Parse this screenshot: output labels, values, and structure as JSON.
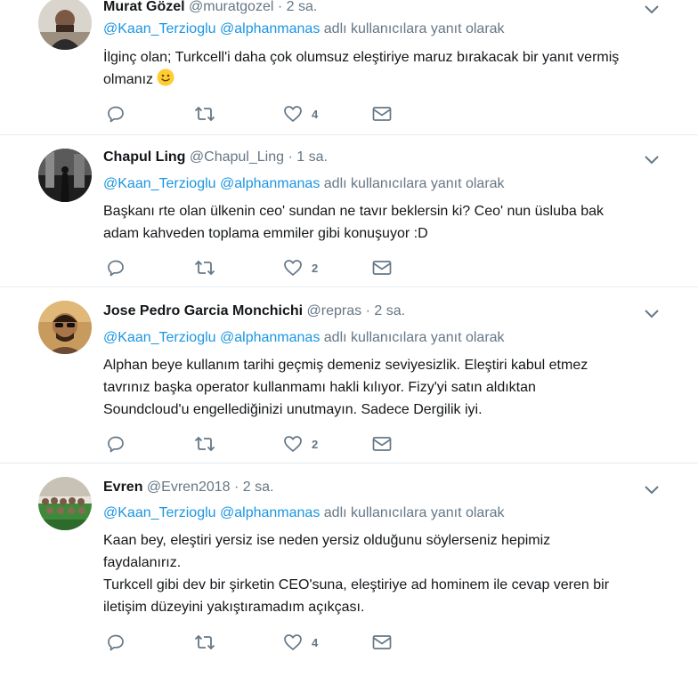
{
  "tweets": [
    {
      "fullname": "Murat Gözel",
      "username": "@muratgozel",
      "dot": "·",
      "time": "2 sa.",
      "reply_mention_1": "@Kaan_Terzioglu",
      "reply_mention_2": "@alphanmanas",
      "reply_suffix": "adlı kullanıcılara yanıt olarak",
      "text": "İlginç olan; Turkcell'i daha çok olumsuz eleştiriye maruz bırakacak bir yanıt vermiş\nolmanız",
      "emoji": "slightly-smiling-face-icon",
      "like_count": "4"
    },
    {
      "fullname": "Chapul Ling",
      "username": "@Chapul_Ling",
      "dot": "·",
      "time": "1 sa.",
      "reply_mention_1": "@Kaan_Terzioglu",
      "reply_mention_2": "@alphanmanas",
      "reply_suffix": "adlı kullanıcılara yanıt olarak",
      "text": "Başkanı rte olan ülkenin ceo' sundan ne tavır beklersin ki? Ceo' nun üsluba bak\nadam kahveden toplama emmiler gibi konuşuyor :D",
      "like_count": "2"
    },
    {
      "fullname": "Jose Pedro Garcia Monchichi",
      "username": "@repras",
      "dot": "·",
      "time": "2 sa.",
      "reply_mention_1": "@Kaan_Terzioglu",
      "reply_mention_2": "@alphanmanas",
      "reply_suffix": "adlı kullanıcılara yanıt olarak",
      "text": "Alphan beye kullanım tarihi geçmiş demeniz seviyesizlik. Eleştiri kabul etmez\ntavrınız başka operator kullanmamı hakli kılıyor. Fizy'yi satın aldıktan\nSoundcloud'u engellediğinizi unutmayın. Sadece Dergilik iyi.",
      "like_count": "2"
    },
    {
      "fullname": "Evren",
      "username": "@Evren2018",
      "dot": "·",
      "time": "2 sa.",
      "reply_mention_1": "@Kaan_Terzioglu",
      "reply_mention_2": "@alphanmanas",
      "reply_suffix": "adlı kullanıcılara yanıt olarak",
      "text": "Kaan bey, eleştiri yersiz ise neden yersiz olduğunu söylerseniz hepimiz\nfaydalanırız.\nTurkcell gibi dev bir şirketin CEO'suna, eleştiriye ad hominem ile cevap veren bir\niletişim düzeyini yakıştıramadım açıkçası.",
      "like_count": "4"
    }
  ],
  "icons": {
    "reply": "reply-icon",
    "retweet": "retweet-icon",
    "like": "heart-icon",
    "dm": "envelope-icon",
    "menu": "chevron-down-icon"
  },
  "colors": {
    "mention": "#1b95e0",
    "secondary_text": "#657786",
    "divider": "#e6ecf0",
    "action_icon": "#657786"
  }
}
